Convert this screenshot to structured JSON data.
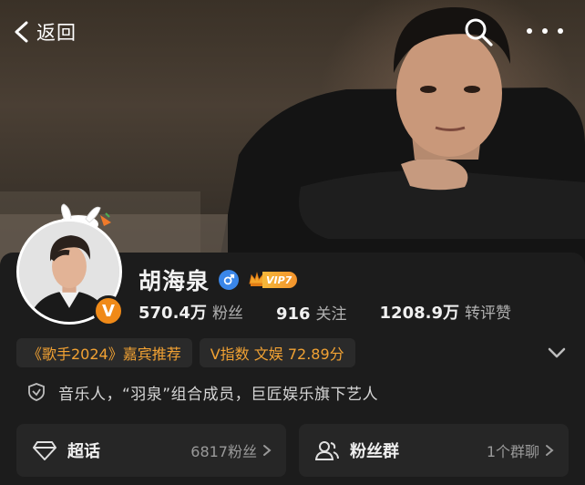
{
  "topbar": {
    "back_label": "返回",
    "back_icon": "chevron-left-icon",
    "search_icon": "search-icon",
    "more_icon": "more-dots-icon"
  },
  "profile": {
    "name": "胡海泉",
    "gender": "male",
    "vip_label": "VIP7",
    "stats": [
      {
        "value": "570.4万",
        "label": "粉丝"
      },
      {
        "value": "916",
        "label": "关注"
      },
      {
        "value": "1208.9万",
        "label": "转评赞"
      }
    ],
    "tags": [
      {
        "text": "《歌手2024》嘉宾推荐"
      },
      {
        "text": "V指数 文娱 72.89分"
      }
    ],
    "bio": "音乐人，“羽泉”组合成员，巨匠娱乐旗下艺人"
  },
  "entries": [
    {
      "title": "超话",
      "meta": "6817粉丝",
      "icon": "diamond-icon"
    },
    {
      "title": "粉丝群",
      "meta": "1个群聊",
      "icon": "group-icon"
    }
  ],
  "colors": {
    "accent_orange": "#f2a233",
    "verified_orange": "#f08a18",
    "gender_blue": "#3a86e8",
    "card_bg": "#1c1c1c"
  }
}
